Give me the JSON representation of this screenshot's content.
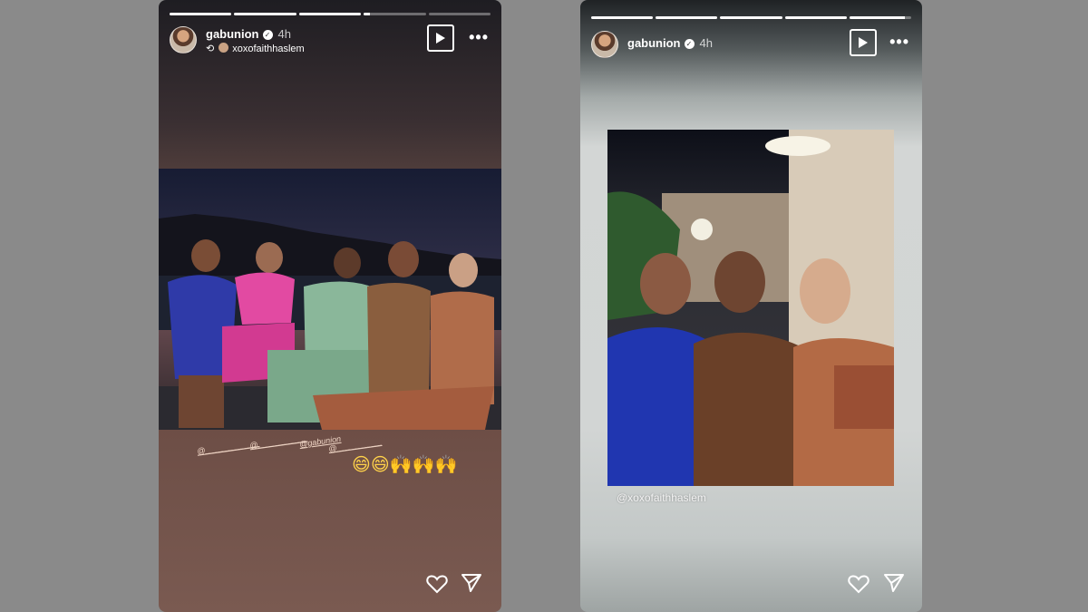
{
  "stories": [
    {
      "username": "gabunion",
      "time": "4h",
      "repost_user": "xoxofaithhaslem",
      "progress": [
        1,
        1,
        1,
        0.1,
        0
      ],
      "tags": [
        "@____________",
        "@___________",
        "@gabunion",
        "@__________"
      ],
      "emoji_line": "😄😄🙌🙌🙌"
    },
    {
      "username": "gabunion",
      "time": "4h",
      "mention": "@xoxofaithhaslem",
      "progress": [
        1,
        1,
        1,
        1,
        0.9
      ]
    }
  ],
  "icons": {
    "verified": "✓",
    "repost": "⟲",
    "more": "•••"
  }
}
